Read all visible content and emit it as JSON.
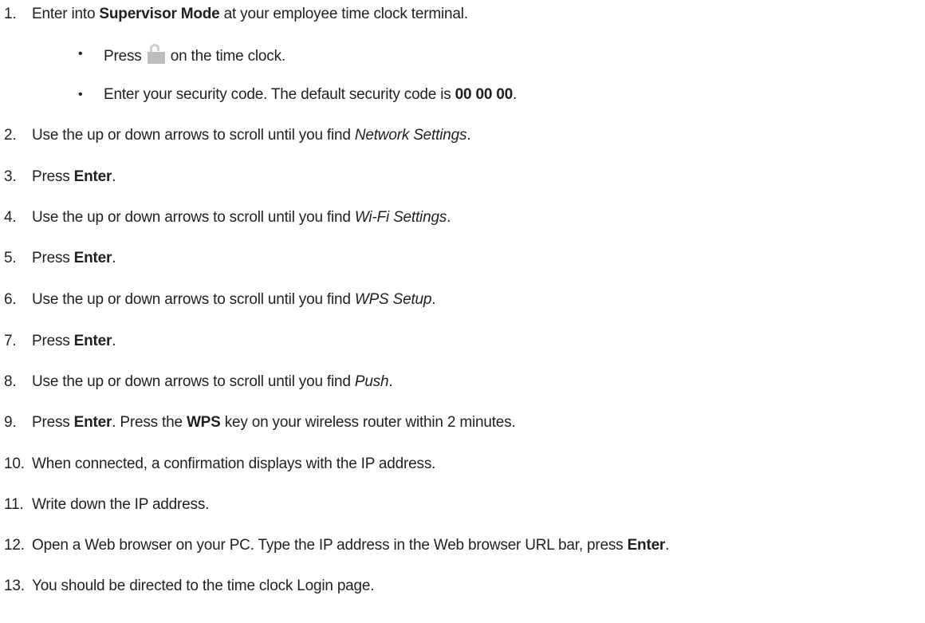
{
  "steps": [
    {
      "num": "1.",
      "parts": [
        {
          "t": "Enter into "
        },
        {
          "t": "Supervisor Mode",
          "s": "b"
        },
        {
          "t": " at your employee time clock terminal."
        }
      ]
    },
    {
      "num": "2.",
      "parts": [
        {
          "t": "Use the up or down arrows to scroll until you find "
        },
        {
          "t": "Network Settings",
          "s": "i"
        },
        {
          "t": "."
        }
      ]
    },
    {
      "num": "3.",
      "parts": [
        {
          "t": "Press "
        },
        {
          "t": "Enter",
          "s": "b"
        },
        {
          "t": "."
        }
      ]
    },
    {
      "num": "4.",
      "parts": [
        {
          "t": "Use the up or down arrows to scroll until you find "
        },
        {
          "t": "Wi-Fi Settings",
          "s": "i"
        },
        {
          "t": "."
        }
      ]
    },
    {
      "num": "5.",
      "parts": [
        {
          "t": "Press "
        },
        {
          "t": "Enter",
          "s": "b"
        },
        {
          "t": "."
        }
      ]
    },
    {
      "num": "6.",
      "parts": [
        {
          "t": "Use the up or down arrows to scroll until you find "
        },
        {
          "t": "WPS Setup",
          "s": "i"
        },
        {
          "t": "."
        }
      ]
    },
    {
      "num": "7.",
      "parts": [
        {
          "t": "Press "
        },
        {
          "t": "Enter",
          "s": "b"
        },
        {
          "t": "."
        }
      ]
    },
    {
      "num": "8.",
      "parts": [
        {
          "t": "Use the up or down arrows to scroll until you find "
        },
        {
          "t": "Push",
          "s": "i"
        },
        {
          "t": "."
        }
      ]
    },
    {
      "num": "9.",
      "parts": [
        {
          "t": "Press "
        },
        {
          "t": "Enter",
          "s": "b"
        },
        {
          "t": ". Press the "
        },
        {
          "t": "WPS",
          "s": "b"
        },
        {
          "t": " key on your wireless router within 2 minutes."
        }
      ]
    },
    {
      "num": "10.",
      "parts": [
        {
          "t": "When connected, a confirmation displays with the IP address."
        }
      ]
    },
    {
      "num": "11.",
      "parts": [
        {
          "t": "Write down the IP address."
        }
      ]
    },
    {
      "num": "12.",
      "parts": [
        {
          "t": "Open a Web browser on your PC. Type the IP address in the Web browser URL bar, press "
        },
        {
          "t": "Enter",
          "s": "b"
        },
        {
          "t": "."
        }
      ]
    },
    {
      "num": "13.",
      "parts": [
        {
          "t": "You should be directed to the time clock Login page."
        }
      ]
    }
  ],
  "substeps": [
    {
      "bullet": "•",
      "parts": [
        {
          "t": "Press "
        },
        {
          "icon": "lock-icon"
        },
        {
          "t": " on the time clock."
        }
      ]
    },
    {
      "bullet": "•",
      "parts": [
        {
          "t": "Enter your security code. The default security code is "
        },
        {
          "t": "00 00 00",
          "s": "b"
        },
        {
          "t": "."
        }
      ]
    }
  ]
}
